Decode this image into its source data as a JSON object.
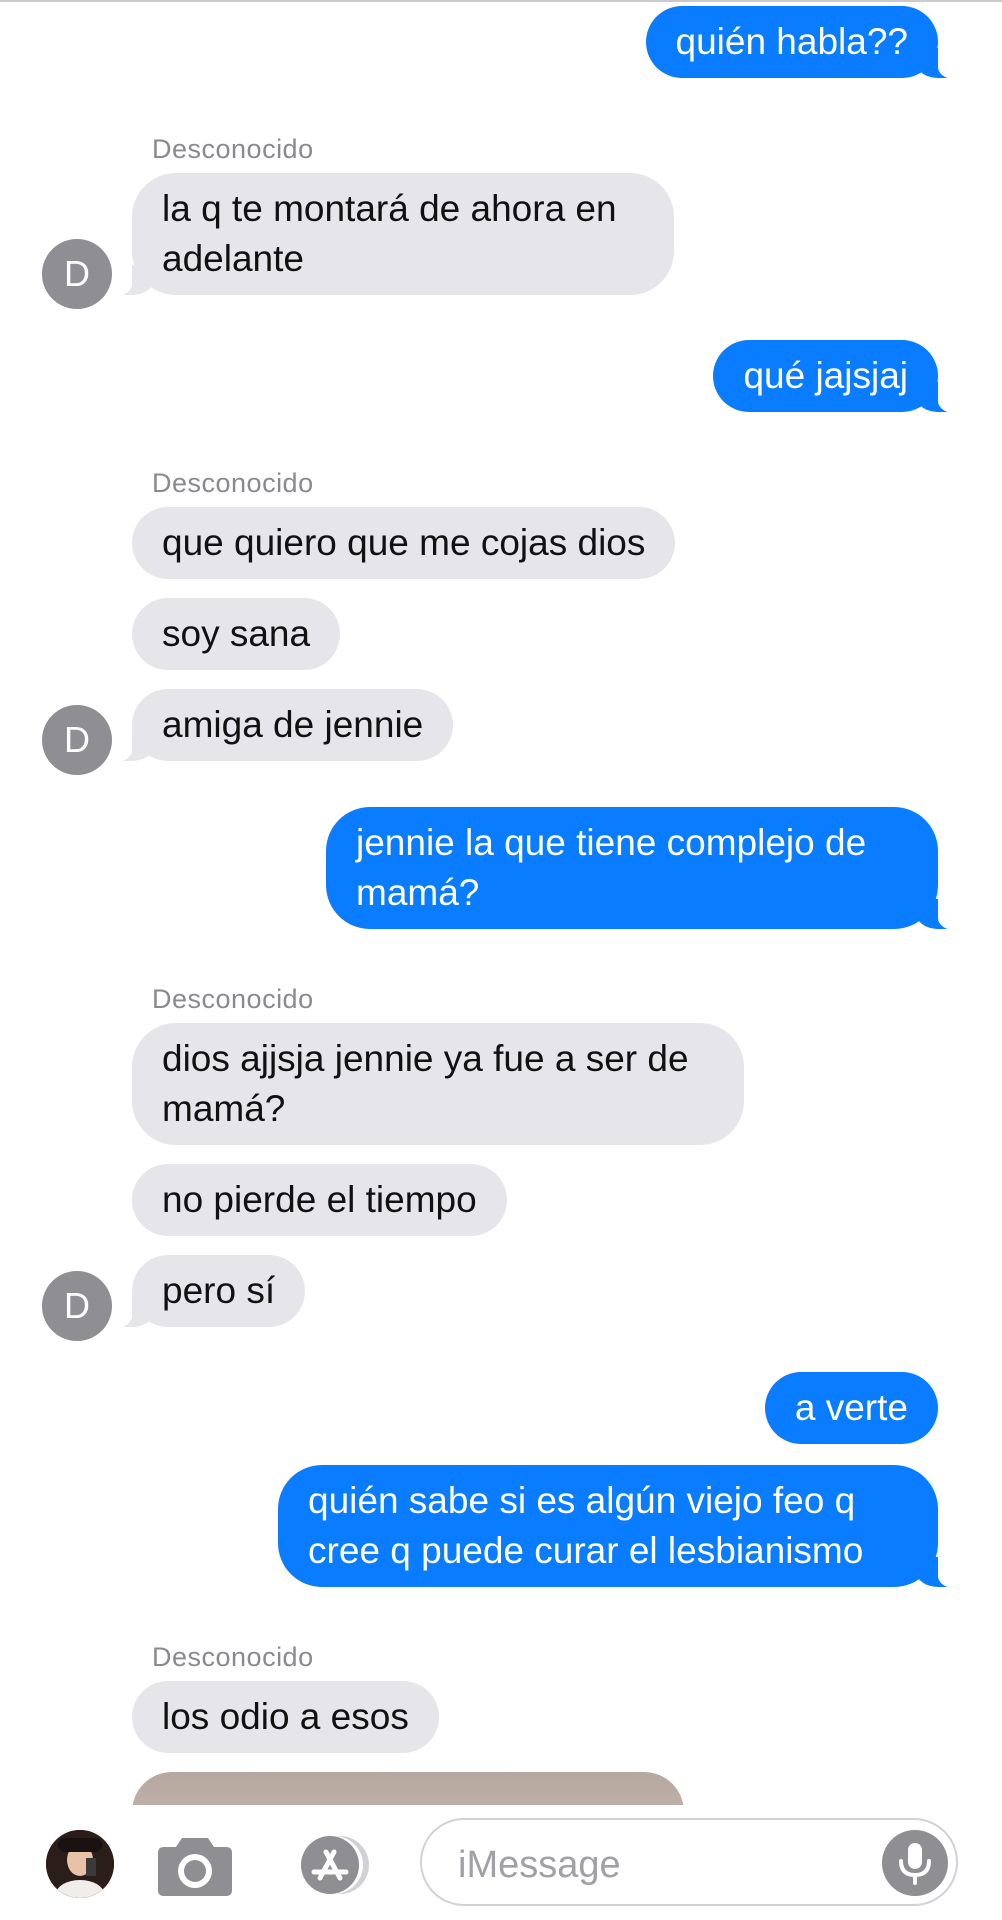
{
  "conversation": {
    "sender_label": "Desconocido",
    "avatar_initial": "D",
    "messages": [
      "quién habla??",
      "la q te montará de ahora en adelante",
      "qué jajsjaj",
      "que quiero que me cojas dios",
      "soy sana",
      "amiga de jennie",
      "jennie la que tiene complejo de mamá?",
      "dios ajjsja jennie ya fue a ser de mamá?",
      "no pierde el tiempo",
      "pero sí",
      "a verte",
      "quién sabe si es algún viejo feo q cree q puede curar el lesbianismo",
      "los odio a esos"
    ]
  },
  "input_bar": {
    "placeholder": "iMessage",
    "icons": [
      "profile-avatar",
      "camera-icon",
      "app-store-icon",
      "microphone-icon"
    ]
  },
  "colors": {
    "outgoing_bubble": "#0a7cff",
    "incoming_bubble": "#e5e5ea",
    "avatar_gray": "#8e8e93",
    "sender_label": "#8a8a8e"
  }
}
